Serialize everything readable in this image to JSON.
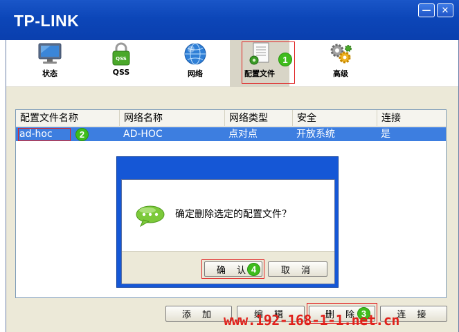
{
  "window": {
    "brand": "TP-LINK",
    "minimize_glyph": "—",
    "close_glyph": "✕"
  },
  "tabs": [
    {
      "label": "状态",
      "icon": "monitor-icon"
    },
    {
      "label": "QSS",
      "icon": "qss-lock-icon"
    },
    {
      "label": "网络",
      "icon": "globe-icon"
    },
    {
      "label": "配置文件",
      "icon": "profile-document-icon",
      "selected": true
    },
    {
      "label": "高级",
      "icon": "gears-icon"
    }
  ],
  "profiles": {
    "columns": [
      "配置文件名称",
      "网络名称",
      "网络类型",
      "安全",
      "连接"
    ],
    "rows": [
      {
        "name": "ad-hoc",
        "ssid": "AD-HOC",
        "type": "点对点",
        "security": "开放系统",
        "connected": "是"
      }
    ]
  },
  "dialog": {
    "message": "确定删除选定的配置文件？",
    "confirm_label": "确 认",
    "cancel_label": "取 消"
  },
  "buttons": {
    "add": "添 加",
    "edit": "编 辑",
    "delete": "删 除",
    "connect": "连 接"
  },
  "badges": {
    "one": "1",
    "two": "2",
    "three": "3",
    "four": "4"
  },
  "watermark": "www.192-168-1-1.net.cn",
  "colors": {
    "titlebar": "#0c46b8",
    "selection": "#3d7ee0",
    "highlight": "#e02020",
    "badge": "#3fbc1c"
  }
}
